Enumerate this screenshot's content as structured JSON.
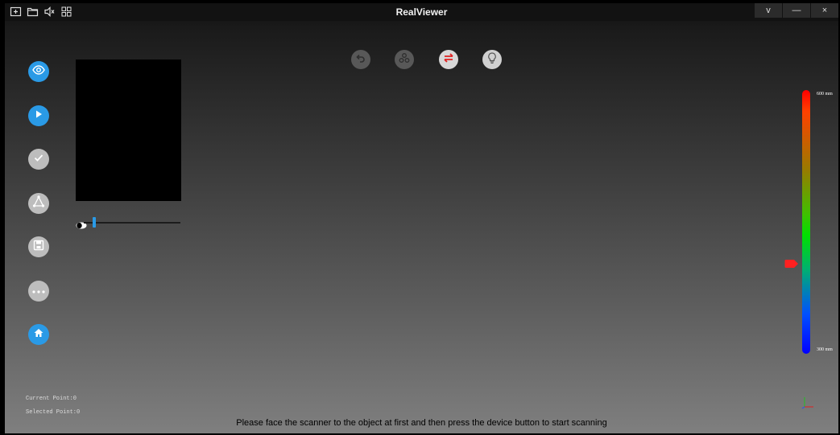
{
  "window": {
    "title": "RealViewer",
    "buttons": [
      "v",
      "—",
      "×"
    ]
  },
  "toolbar_icons": [
    "new-project-icon",
    "open-folder-icon",
    "mute-icon",
    "grid-icon"
  ],
  "sidebar": {
    "items": [
      {
        "name": "preview",
        "icon": "eye-icon",
        "style": "blue"
      },
      {
        "name": "play",
        "icon": "play-icon",
        "style": "blue"
      },
      {
        "name": "confirm",
        "icon": "check-icon",
        "style": "grey"
      },
      {
        "name": "mesh",
        "icon": "mesh-triangle-icon",
        "style": "grey"
      },
      {
        "name": "save",
        "icon": "save-icon",
        "style": "grey"
      },
      {
        "name": "more",
        "icon": "more-icon",
        "style": "grey"
      },
      {
        "name": "home",
        "icon": "home-icon",
        "style": "blue"
      }
    ]
  },
  "top_tools": [
    {
      "name": "undo",
      "icon": "undo-icon"
    },
    {
      "name": "points",
      "icon": "points-icon"
    },
    {
      "name": "swap",
      "icon": "swap-icon"
    },
    {
      "name": "light",
      "icon": "lightbulb-icon"
    }
  ],
  "depth_scale": {
    "max_label": "600 mm",
    "min_label": "300 mm",
    "marker_level": 0.67
  },
  "stats": {
    "current_point": "Current Point:0",
    "selected_point": "Selected Point:0"
  },
  "status_message": "Please face the scanner to the object at first and then press the device button to start scanning",
  "colors": {
    "accent": "#2a9ae6",
    "marker": "#ff2020"
  }
}
